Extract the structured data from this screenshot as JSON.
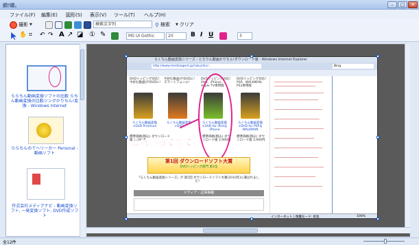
{
  "window": {
    "title": "繝ｦ繝｡",
    "minimize": "–",
    "maximize": "□",
    "close": "✕"
  },
  "menu": [
    "ファイル(F)",
    "編集(E)",
    "図形(S)",
    "表示(V)",
    "ツール(T)",
    "ヘルプ(H)"
  ],
  "toolbar1": {
    "capture_label": "撮影",
    "search_input_value": "検索文字列",
    "search_button": "検索",
    "clear_button": "クリア"
  },
  "toolbar2": {
    "font_family": "MS UI Gothic",
    "font_size": "20",
    "bold": "B",
    "italic": "I",
    "underline": "U",
    "line_width": "3"
  },
  "sidebar": {
    "items": [
      {
        "caption": "ららちん動画変換ソフトの比較 らちん動画変換の比較ジングかりちん!変換 - Windows Internet"
      },
      {
        "caption": "ららちんのでヘリーカー Personal - 動画ソフト"
      },
      {
        "caption": "作式会社メディアナビ - 動画変換ソフト, 一発変換ソフト, DVD作成ソフト"
      }
    ]
  },
  "screenshot": {
    "ie_title": "らくちん動画変換シリーズ - とらりん動画かりちん!ダウンロード版 - Windows Internet Explorer",
    "address": "http://www.mediaagent.jp/rakuchin/...",
    "search_engine": "Bing",
    "products": [
      {
        "desc": "DVDリッピング対応！今好む動画が!DVDに!",
        "link": "らくちん動画変換+DVD Premium"
      },
      {
        "desc": "今好む動画が!DVDに!スマートフォンに!",
        "link": "らくちん動画変換+DVD"
      },
      {
        "desc": "DVDリッピング対応！iPod、iPhone、Apple TV専用版",
        "link": "らくちん動画変換+DVD for iPod＆iPhone"
      },
      {
        "desc": "DVDリッピング対応！PSP、WALKMAN、PS3専用版",
        "link": "らくちん動画変換+DVD for PSP＆WALKMAN"
      }
    ],
    "price_text": "標準価格(税込) ダウンロード版 3,990円",
    "annotation": "これ買ってきて",
    "banner_main": "第1回 ダウンロードソフト大賞",
    "banner_sub": "DVDリッピング部門 第1位",
    "footer_text": "「らくちん動画変換シリーズ」が 第1回 ダウンロードソフト大賞(2010年)に選ばれました！",
    "news_header": "メディア・記事掲載",
    "ie_status": "インターネット | 保護モード: 有効",
    "ie_zoom": "100%"
  },
  "status": {
    "count": "全12件",
    "zoom": "100%"
  },
  "colors": {
    "accent": "#1a5fd0",
    "annotation": "#e0218a",
    "canvas_bg": "#5a5a5a"
  }
}
